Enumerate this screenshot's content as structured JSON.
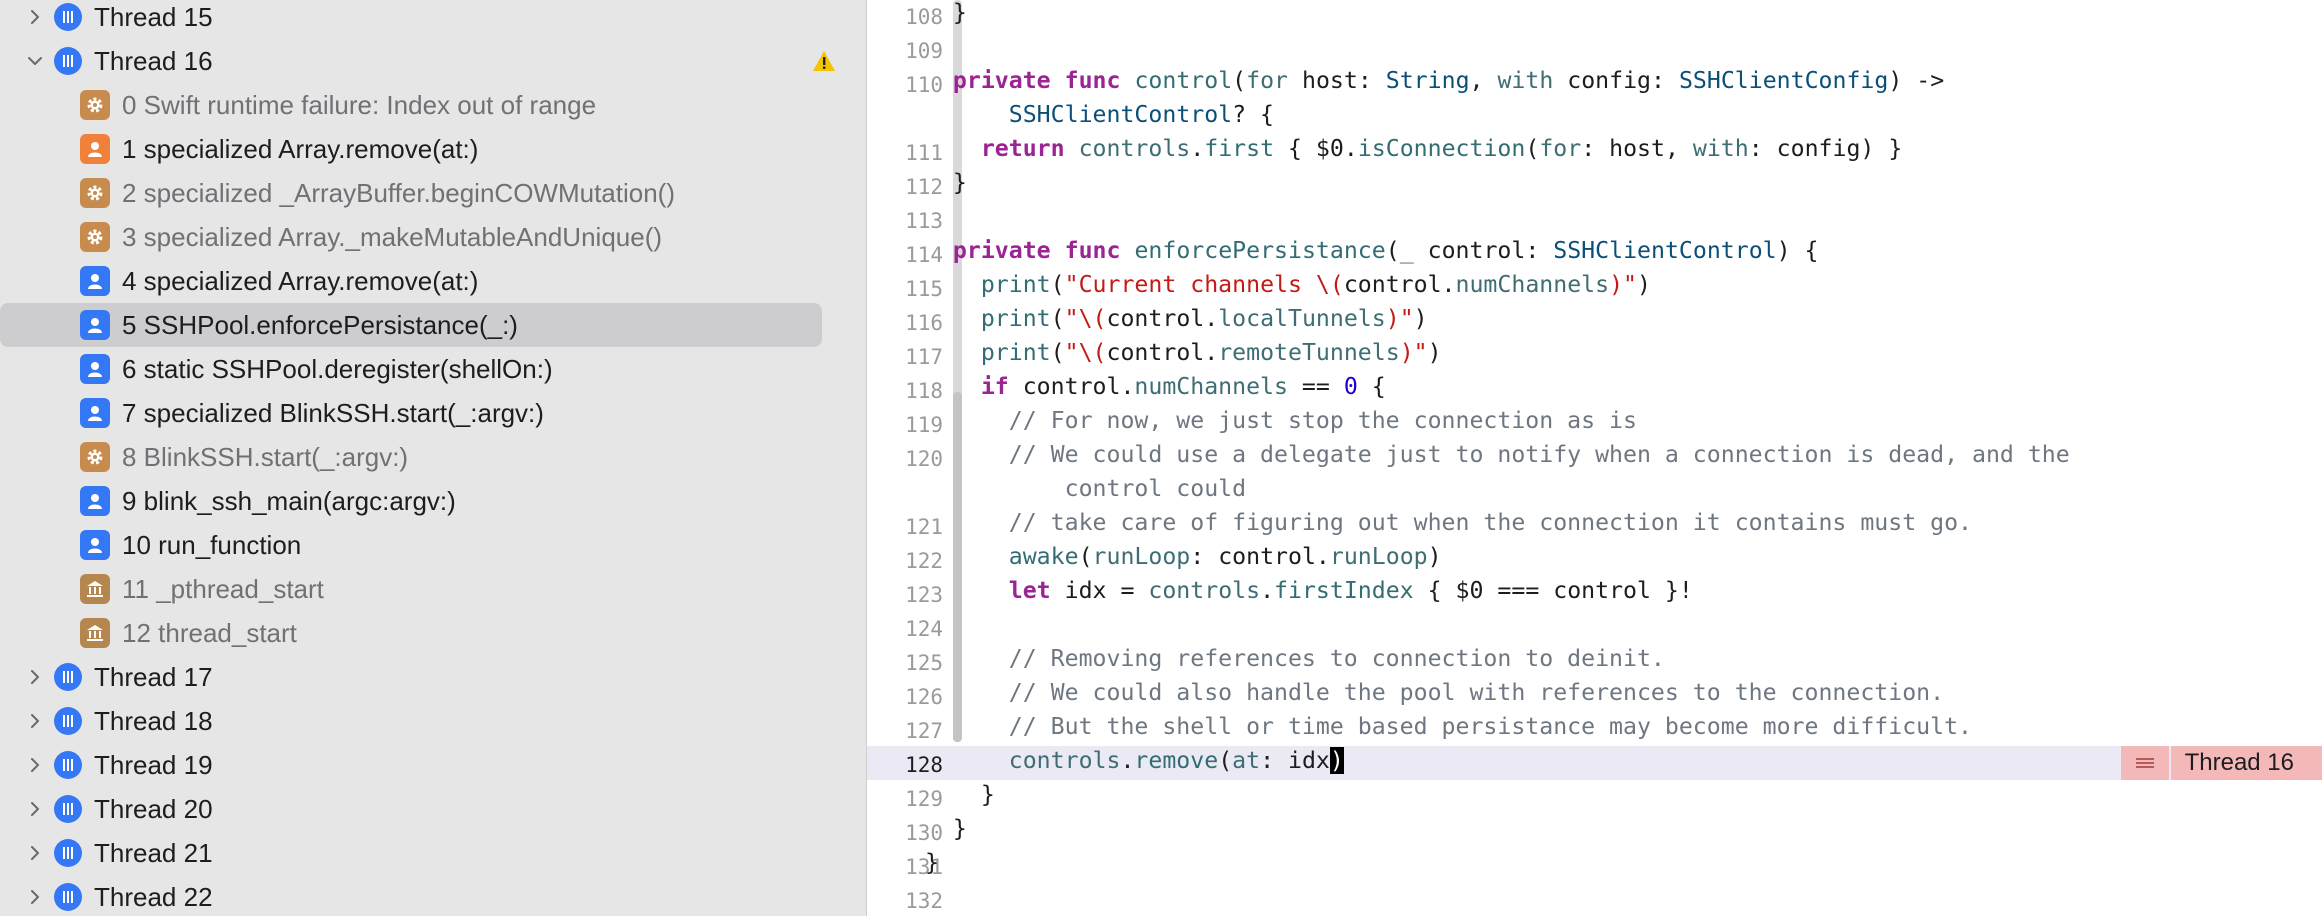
{
  "navigator": {
    "threads_before": [
      {
        "label": "Thread 15"
      }
    ],
    "expanded_thread": {
      "label": "Thread 16"
    },
    "frames": [
      {
        "label": "0 Swift runtime failure: Index out of range",
        "kind": "system-gear"
      },
      {
        "label": "1 specialized Array.remove(at:)",
        "kind": "user-orange"
      },
      {
        "label": "2 specialized _ArrayBuffer.beginCOWMutation()",
        "kind": "system-gear"
      },
      {
        "label": "3 specialized Array._makeMutableAndUnique()",
        "kind": "system-gear"
      },
      {
        "label": "4 specialized Array.remove(at:)",
        "kind": "user-blue"
      },
      {
        "label": "5 SSHPool.enforcePersistance(_:)",
        "kind": "user-blue"
      },
      {
        "label": "6 static SSHPool.deregister(shellOn:)",
        "kind": "user-blue"
      },
      {
        "label": "7 specialized BlinkSSH.start(_:argv:)",
        "kind": "user-blue"
      },
      {
        "label": "8 BlinkSSH.start(_:argv:)",
        "kind": "system-gear"
      },
      {
        "label": "9 blink_ssh_main(argc:argv:)",
        "kind": "user-blue"
      },
      {
        "label": "10 run_function",
        "kind": "user-blue"
      },
      {
        "label": "11 _pthread_start",
        "kind": "library"
      },
      {
        "label": "12 thread_start",
        "kind": "library"
      }
    ],
    "threads_after": [
      {
        "label": "Thread 17"
      },
      {
        "label": "Thread 18"
      },
      {
        "label": "Thread 19"
      },
      {
        "label": "Thread 20"
      },
      {
        "label": "Thread 21"
      },
      {
        "label": "Thread 22"
      }
    ]
  },
  "editor": {
    "line_numbers": [
      "108",
      "109",
      "110",
      "",
      "111",
      "112",
      "113",
      "114",
      "115",
      "116",
      "117",
      "118",
      "119",
      "120",
      "",
      "121",
      "122",
      "123",
      "124",
      "125",
      "126",
      "127",
      "128",
      "129",
      "130",
      "131",
      "132"
    ],
    "current_line": "128",
    "badge": {
      "label": "Thread 16"
    }
  },
  "colors": {
    "thread_blue": "#3478f6",
    "frame_orange": "#f0813a",
    "frame_gear": "#c78b4d",
    "frame_library": "#b6864f",
    "warning": "#f5c400",
    "badge_bg": "#f4b8b8"
  }
}
